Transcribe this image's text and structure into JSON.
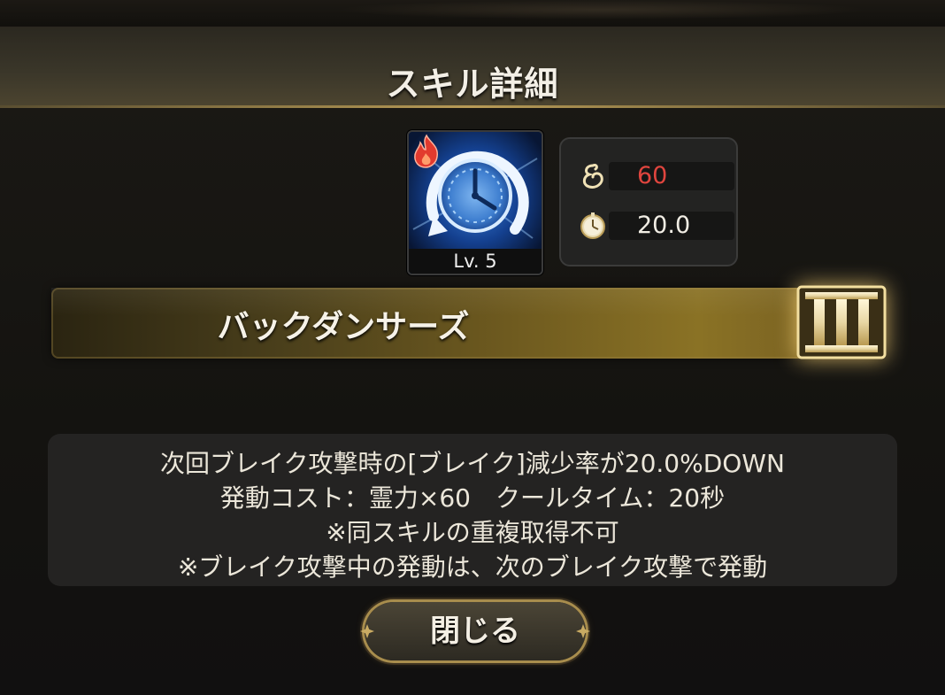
{
  "dialog": {
    "title": "スキル詳細"
  },
  "skill": {
    "level_label": "Lv. 5",
    "icon": "clock-icon",
    "element_icon": "fire-icon",
    "name": "バックダンサーズ",
    "rank": "III"
  },
  "stats": {
    "cost": {
      "icon": "spirit-icon",
      "value": "60",
      "color": "#e0453e"
    },
    "cooldown": {
      "icon": "timer-icon",
      "value": "20.0",
      "color": "#f1ede4"
    }
  },
  "description": {
    "lines": [
      "次回ブレイク攻撃時の[ブレイク]減少率が20.0%DOWN",
      "発動コスト：霊力×60　クールタイム：20秒",
      "※同スキルの重複取得不可",
      "※ブレイク攻撃中の発動は、次のブレイク攻撃で発動"
    ]
  },
  "buttons": {
    "close_label": "閉じる"
  },
  "colors": {
    "accent_gold": "#b89b56",
    "cost_red": "#e0453e"
  }
}
